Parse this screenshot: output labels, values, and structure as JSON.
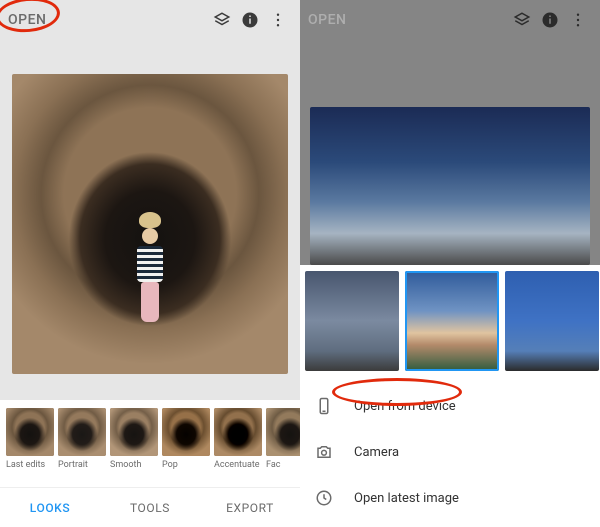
{
  "left": {
    "header": {
      "open": "OPEN"
    },
    "thumbs": [
      {
        "label": "Last edits"
      },
      {
        "label": "Portrait"
      },
      {
        "label": "Smooth"
      },
      {
        "label": "Pop"
      },
      {
        "label": "Accentuate"
      },
      {
        "label": "Fac"
      }
    ],
    "tabs": {
      "looks": "LOOKS",
      "tools": "TOOLS",
      "export": "EXPORT"
    }
  },
  "right": {
    "header": {
      "open": "OPEN"
    },
    "actions": {
      "open_from_device": "Open from device",
      "camera": "Camera",
      "open_latest": "Open latest image"
    }
  }
}
